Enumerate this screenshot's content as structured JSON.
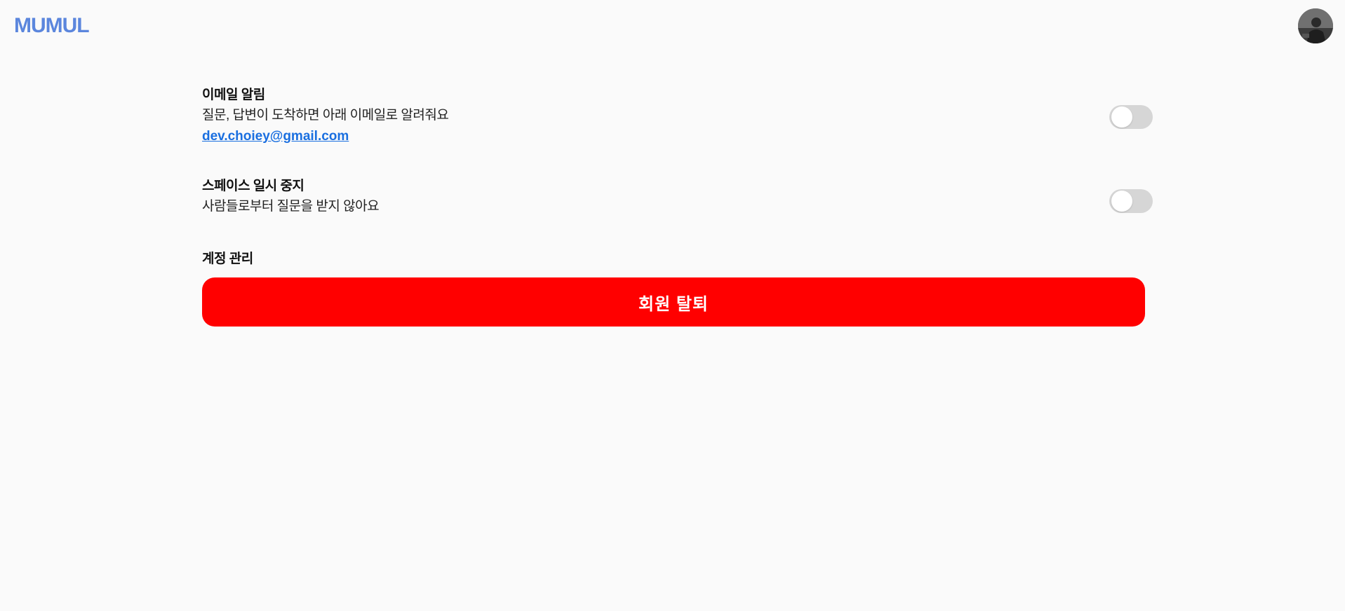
{
  "header": {
    "logo": "MUMUL",
    "avatar_icon": "user-avatar"
  },
  "settings": {
    "email_notification": {
      "title": "이메일 알림",
      "description": "질문, 답변이 도착하면 아래 이메일로 알려줘요",
      "email": "dev.choiey@gmail.com",
      "enabled": false
    },
    "space_pause": {
      "title": "스페이스 일시 중지",
      "description": "사람들로부터 질문을 받지 않아요",
      "enabled": false
    }
  },
  "account": {
    "title": "계정 관리",
    "withdraw_label": "회원 탈퇴"
  },
  "colors": {
    "brand": "#5b86dd",
    "danger": "#ff0000",
    "link": "#1a6fe0",
    "toggle_off": "#d6d6d6",
    "background": "#fafafa"
  }
}
